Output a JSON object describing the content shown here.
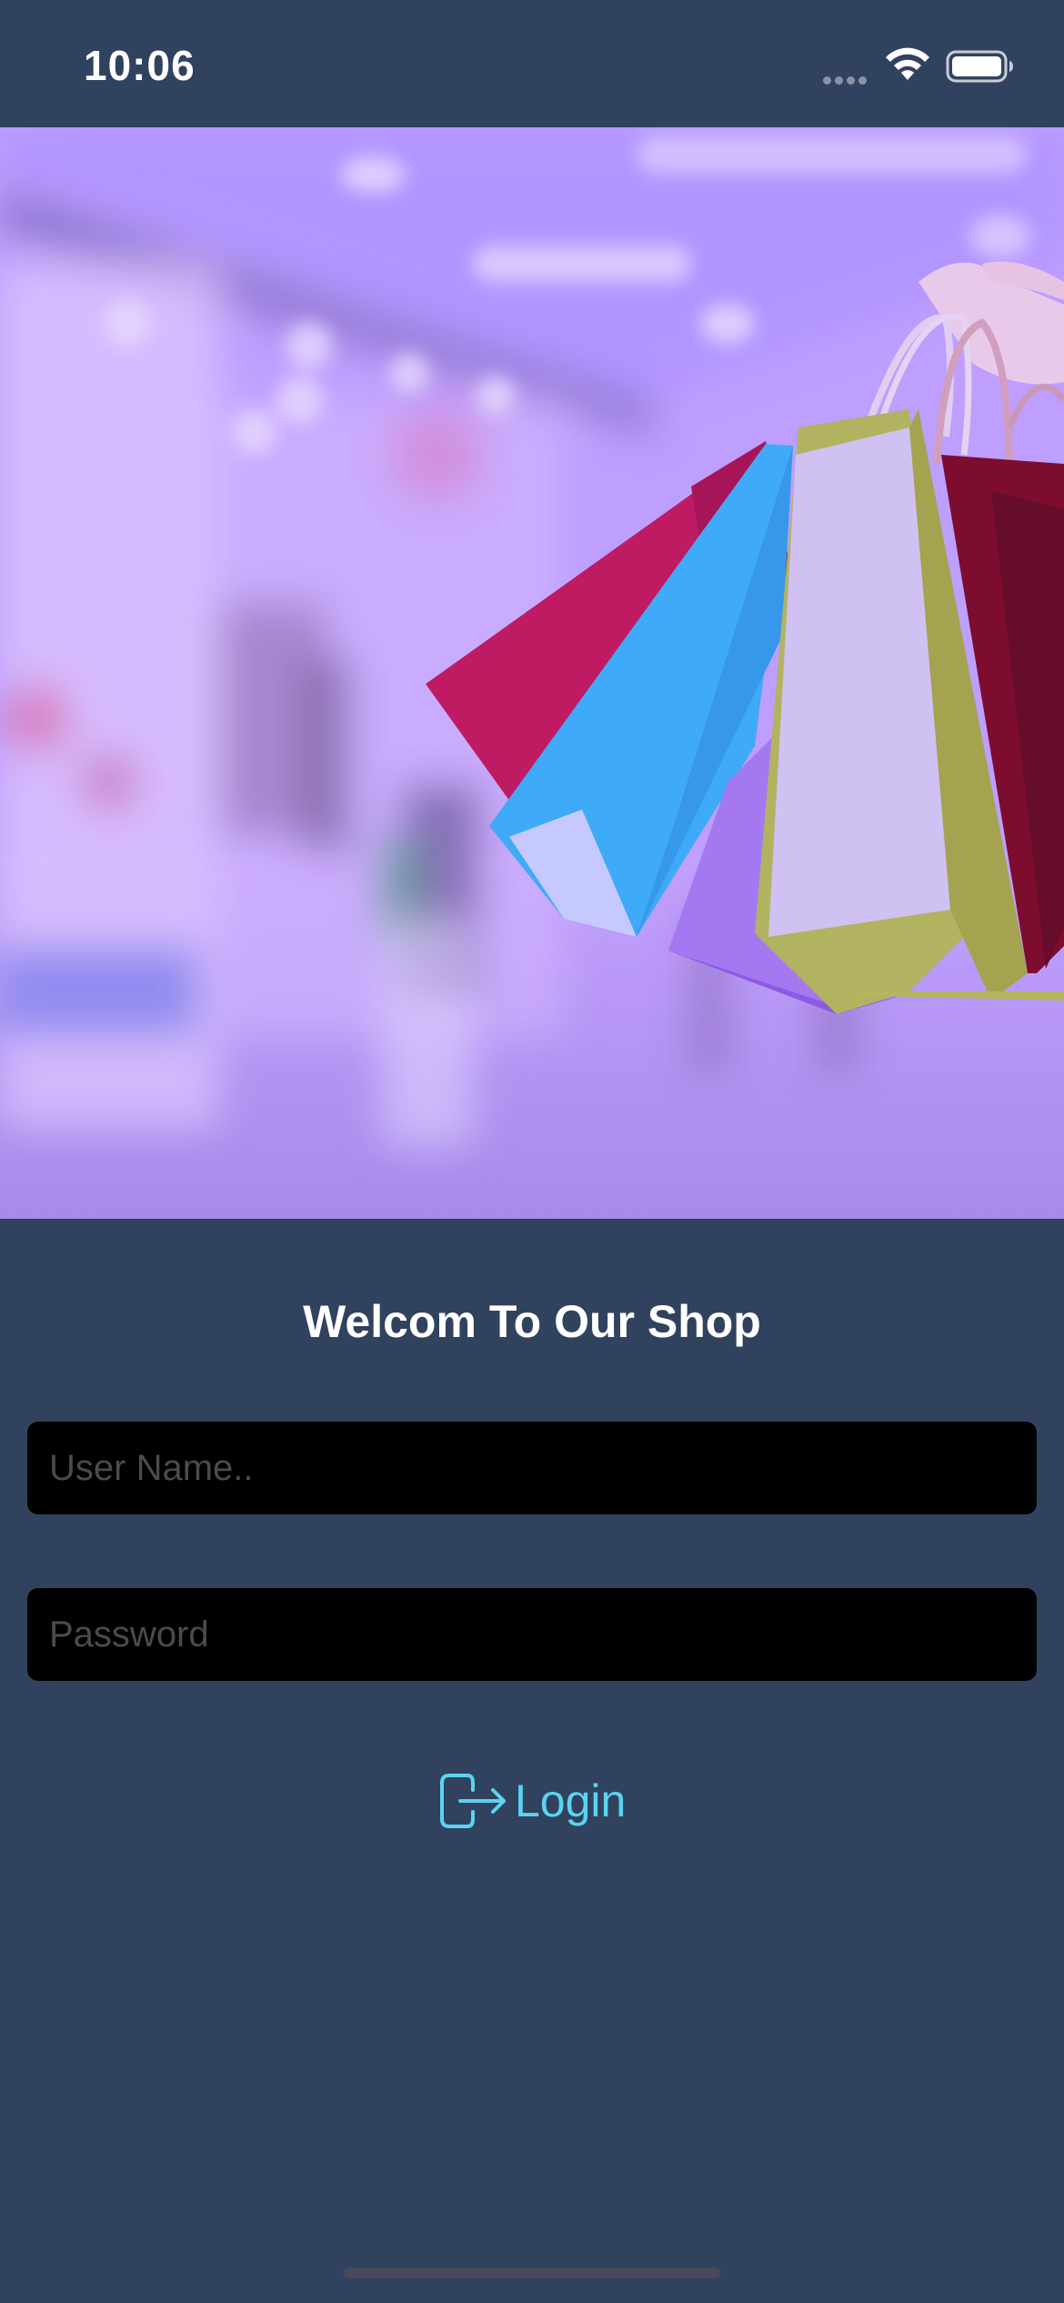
{
  "status_bar": {
    "time": "10:06"
  },
  "hero": {
    "icon": "shopping-bags-photo"
  },
  "login": {
    "title": "Welcom To Our Shop",
    "username_placeholder": "User Name..",
    "username_value": "",
    "password_placeholder": "Password",
    "password_value": "",
    "login_label": "Login",
    "login_icon": "login-arrow-icon"
  },
  "colors": {
    "background": "#31425f",
    "accent": "#5ad4f0",
    "field_background": "#000000",
    "title": "#ffffff"
  }
}
